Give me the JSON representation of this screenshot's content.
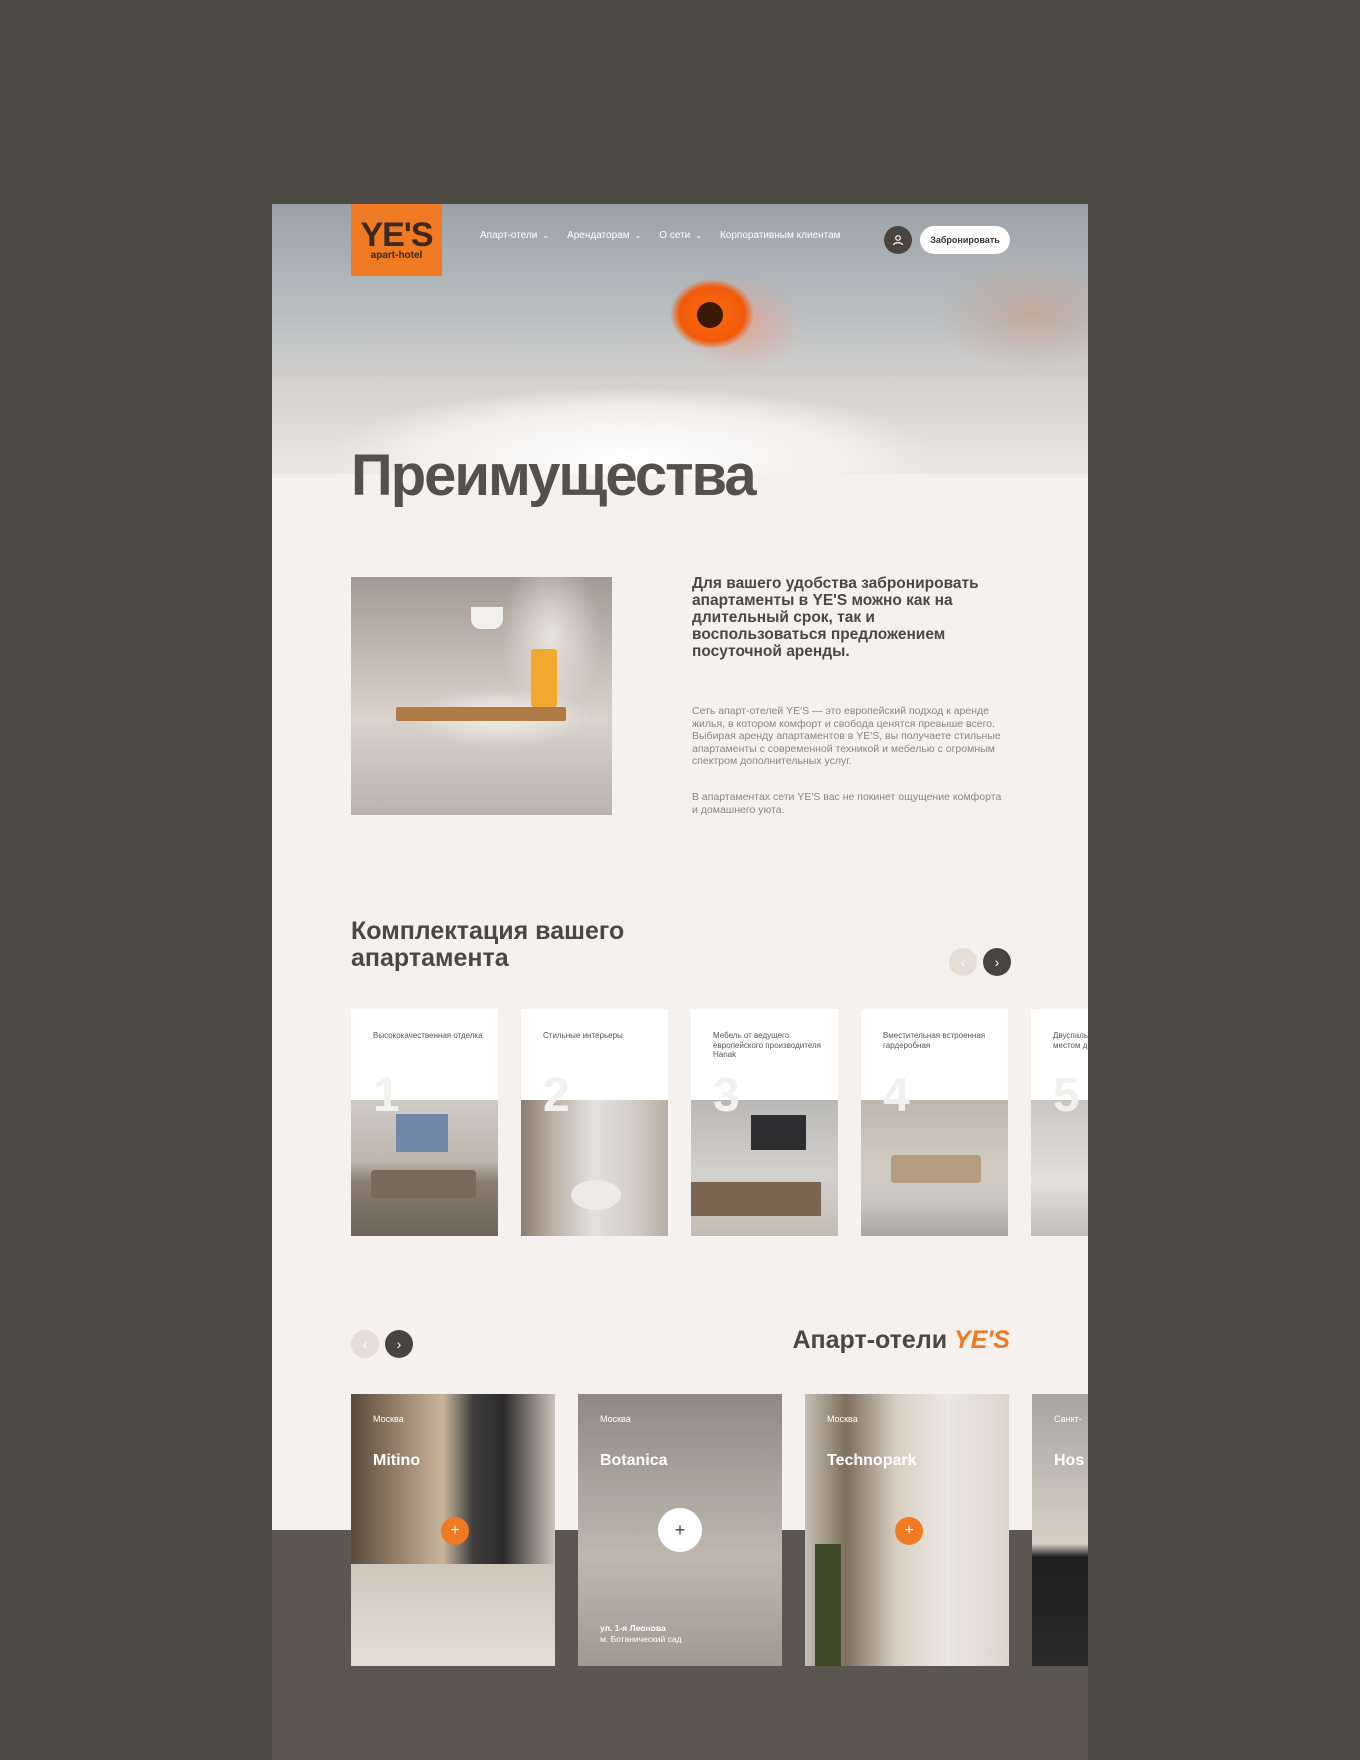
{
  "header": {
    "logo_big": "YE'S",
    "logo_small": "apart-hotel",
    "nav": [
      {
        "label": "Апарт-отели"
      },
      {
        "label": "Арендаторам"
      },
      {
        "label": "О сети"
      },
      {
        "label": "Корпоративным клиентам"
      }
    ],
    "book_label": "Забронировать"
  },
  "hero": {
    "title": "Преимущества"
  },
  "about": {
    "lead": "Для вашего удобства забронировать апартаменты в YE'S можно как на длительный срок, так и воспользоваться предложением посуточной аренды.",
    "p1": "Сеть апарт-отелей YE'S — это европейский подход к аренде жилья, в котором комфорт и свобода ценятся превыше всего. Выбирая аренду апартаментов в YE'S, вы получаете стильные апартаменты с современной техникой и мебелью с огромным спектром дополнительных услуг.",
    "p2": "В апартаментах сети YE'S вас не покинет ощущение комфорта и домашнего уюта."
  },
  "equipment": {
    "title": "Комплектация вашего апартамента",
    "items": [
      {
        "num": "1",
        "text": "Высококачественная отделка"
      },
      {
        "num": "2",
        "text": "Стильные интерьеры"
      },
      {
        "num": "3",
        "text": "Мебель от ведущего европейского производителя Hanak"
      },
      {
        "num": "4",
        "text": "Вместительная встроенная гардеробная"
      },
      {
        "num": "5",
        "text": "Двуспальная подъемная местом д"
      }
    ]
  },
  "hotels": {
    "title_prefix": "Апарт-отели ",
    "title_brand": "YE'S",
    "items": [
      {
        "city": "Москва",
        "name": "Mitino"
      },
      {
        "city": "Москва",
        "name": "Botanica",
        "addr1": "ул. 1-я Леонова",
        "addr2": "м. Ботанический сад"
      },
      {
        "city": "Москва",
        "name": "Technopark"
      },
      {
        "city": "Санкт-",
        "name": "Hos"
      }
    ]
  },
  "icons": {
    "chevron": "⌄",
    "user": "user-icon",
    "arrow_left": "‹",
    "arrow_right": "›",
    "plus": "+"
  },
  "colors": {
    "brand_orange": "#f07a22",
    "dark": "#4a4440",
    "background": "#f5f1ee"
  }
}
